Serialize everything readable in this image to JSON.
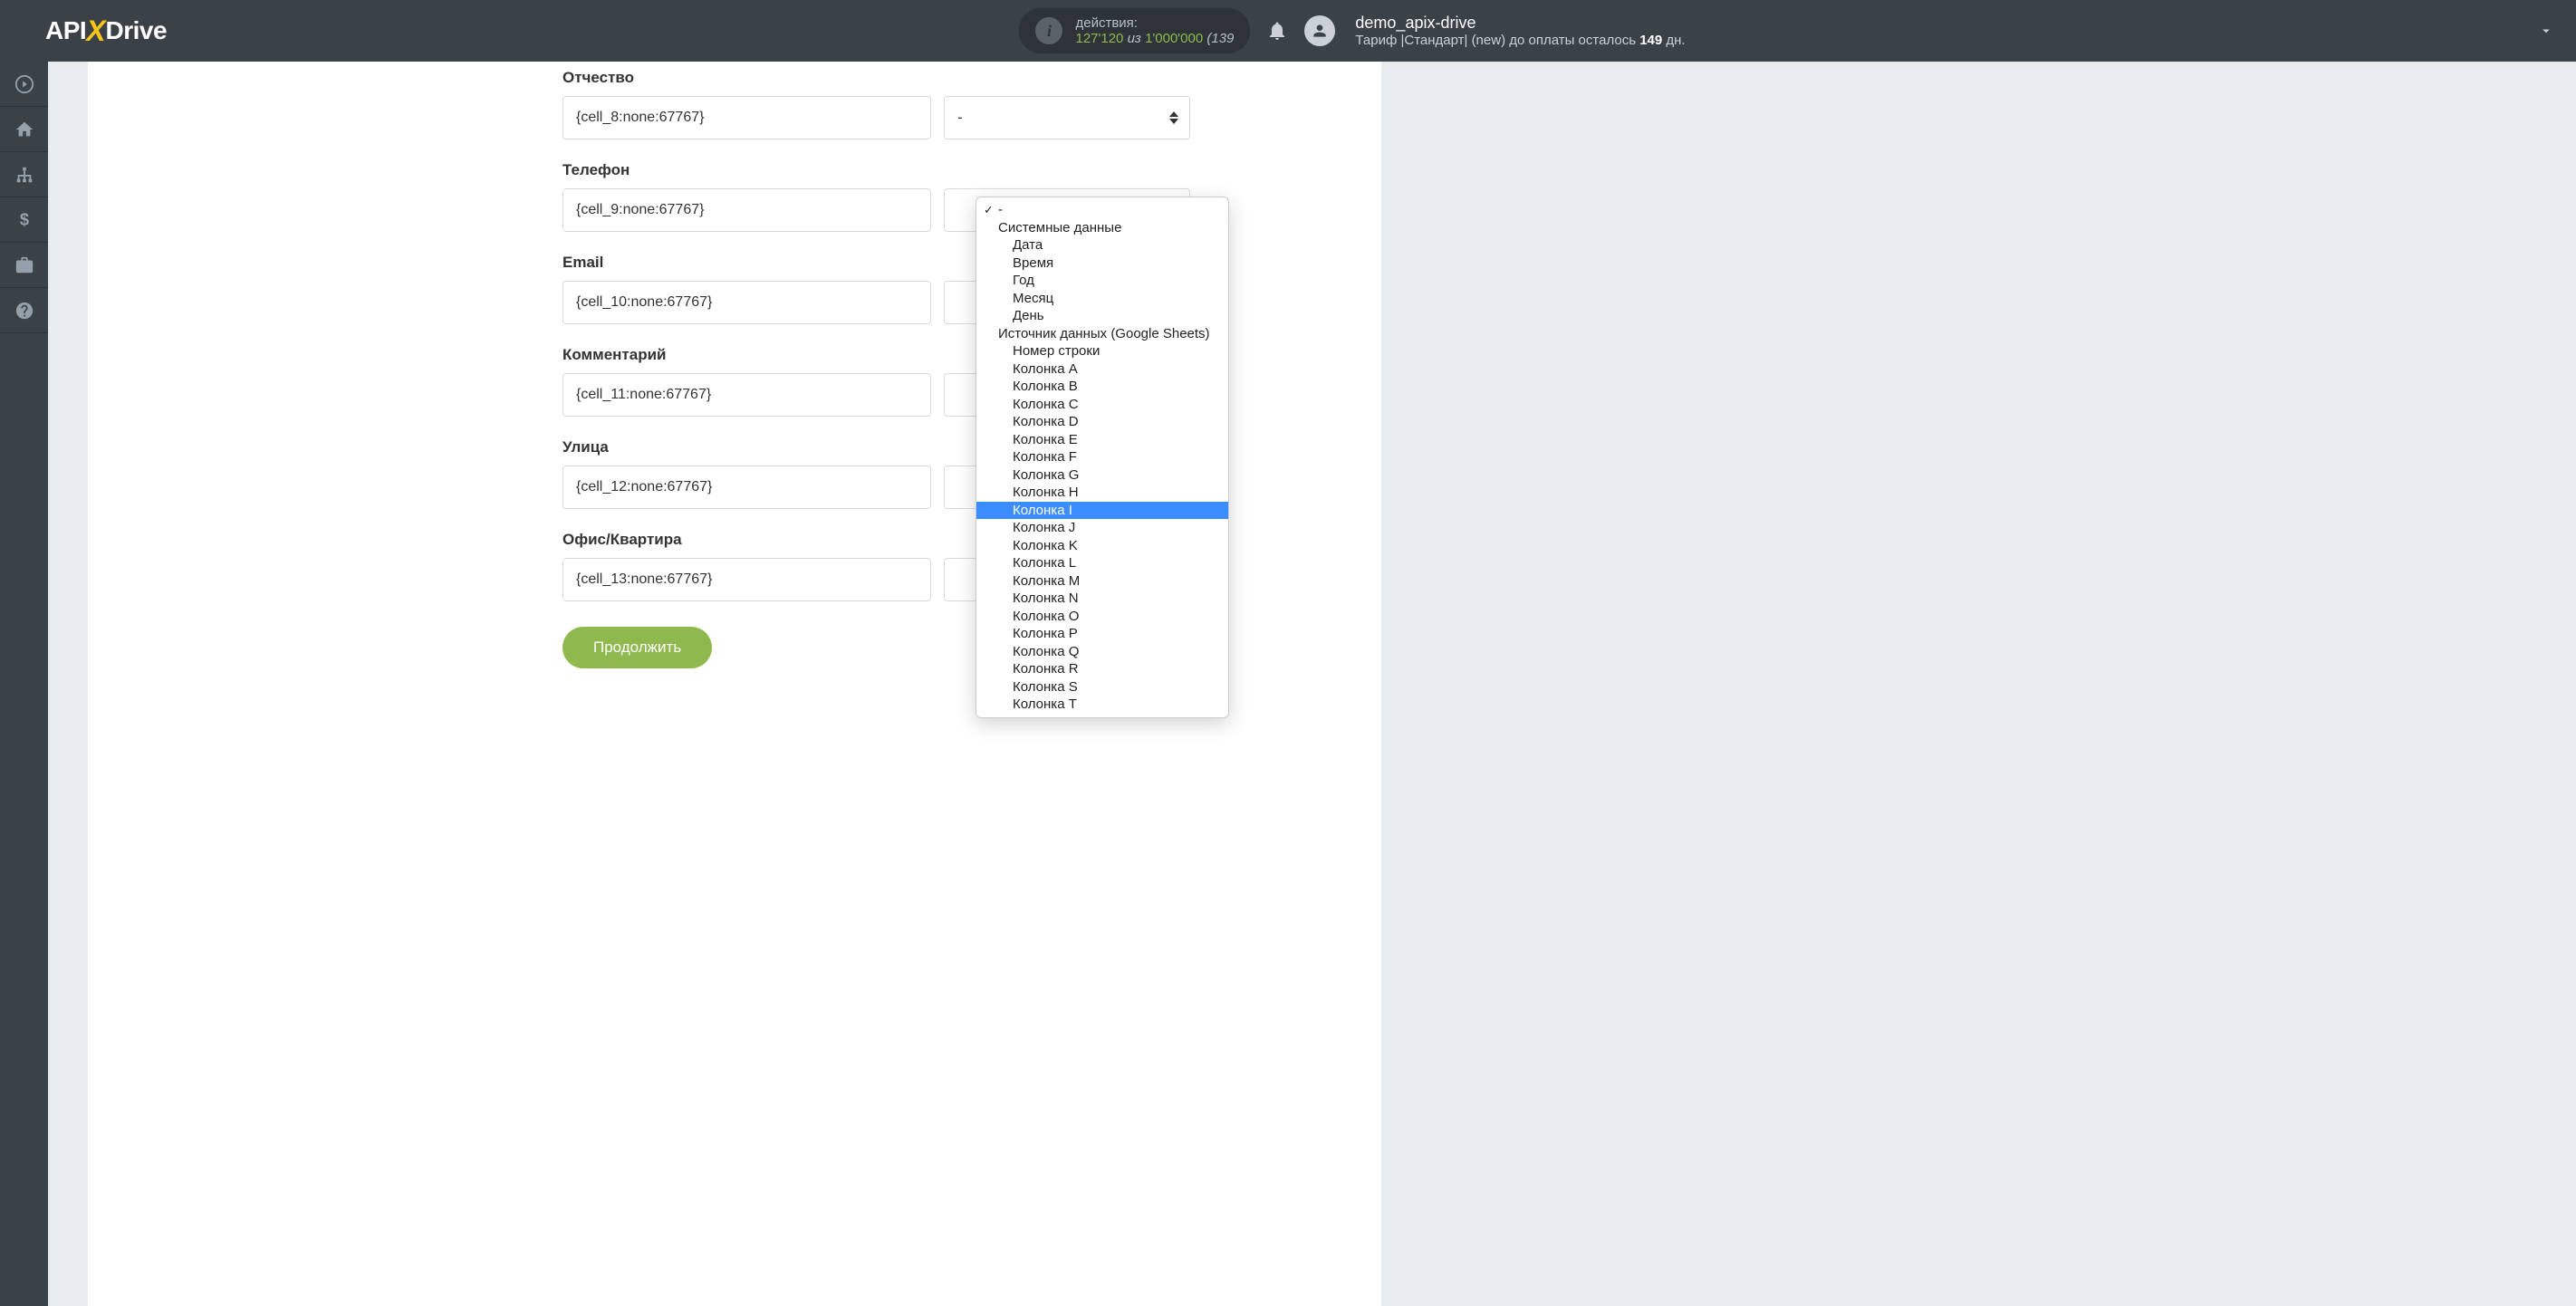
{
  "header": {
    "logo_a": "API",
    "logo_b": "Drive",
    "actions_label": "действия:",
    "actions_count": "127'120",
    "actions_sep": "из",
    "actions_max": "1'000'000",
    "actions_suffix": "(139",
    "username": "demo_apix-drive",
    "tariff_prefix": "Тариф |Стандарт| (new) до оплаты осталось ",
    "tariff_days": "149",
    "tariff_suffix": " дн."
  },
  "fields": [
    {
      "label": "Отчество",
      "value": "{cell_8:none:67767}",
      "select": "-"
    },
    {
      "label": "Телефон",
      "value": "{cell_9:none:67767}",
      "select": ""
    },
    {
      "label": "Email",
      "value": "{cell_10:none:67767}",
      "select": ""
    },
    {
      "label": "Комментарий",
      "value": "{cell_11:none:67767}",
      "select": ""
    },
    {
      "label": "Улица",
      "value": "{cell_12:none:67767}",
      "select": ""
    },
    {
      "label": "Офис/Квартира",
      "value": "{cell_13:none:67767}",
      "select": ""
    }
  ],
  "button_continue": "Продолжить",
  "dropdown": {
    "selected": "-",
    "group1": "Системные данные",
    "group1_items": [
      "Дата",
      "Время",
      "Год",
      "Месяц",
      "День"
    ],
    "group2": "Источник данных (Google Sheets)",
    "group2_items": [
      "Номер строки",
      "Колонка A",
      "Колонка B",
      "Колонка C",
      "Колонка D",
      "Колонка E",
      "Колонка F",
      "Колонка G",
      "Колонка H",
      "Колонка I",
      "Колонка J",
      "Колонка K",
      "Колонка L",
      "Колонка M",
      "Колонка N",
      "Колонка O",
      "Колонка P",
      "Колонка Q",
      "Колонка R",
      "Колонка S",
      "Колонка T"
    ],
    "highlighted": "Колонка I"
  }
}
